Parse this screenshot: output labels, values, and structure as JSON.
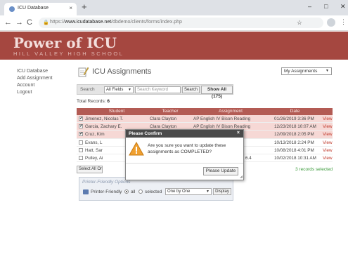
{
  "browser": {
    "tab_title": "ICU Database",
    "tab_close": "×",
    "new_tab": "+",
    "url_prefix": "https://",
    "url_host": "www.icudatabase.net",
    "url_path": "/dbdemo/clients/forms/index.php",
    "window_controls": {
      "minimize": "–",
      "maximize": "□",
      "close": "✕"
    }
  },
  "header": {
    "logo": "Power of ICU",
    "subtitle": "HILL VALLEY HIGH SCHOOL"
  },
  "sidebar": {
    "items": [
      {
        "label": "ICU Database"
      },
      {
        "label": "Add Assignment"
      },
      {
        "label": "Account"
      },
      {
        "label": "Logout"
      }
    ]
  },
  "main": {
    "title": "ICU Assignments",
    "view_select": "My Assignments",
    "search": {
      "label": "Search",
      "field": "All Fields",
      "placeholder": "Search Keyword",
      "button": "Search",
      "show_all": "Show All (175)"
    },
    "total_label": "Total Records:",
    "total_value": "6",
    "columns": [
      "Student",
      "Teacher",
      "Assignment",
      "Date"
    ],
    "rows": [
      {
        "checked": "✔",
        "student": "Jimenez, Nicolas T.",
        "teacher": "Clara Clayton",
        "assignment": "AP English IV Bison Reading",
        "date": "01/26/2019 3:36 PM",
        "view": "View"
      },
      {
        "checked": "✔",
        "student": "Garcia, Zachary E.",
        "teacher": "Clara Clayton",
        "assignment": "AP English IV Bison Reading",
        "date": "12/23/2018 10:07 AM",
        "view": "View"
      },
      {
        "checked": "✔",
        "student": "Cruz, Kim",
        "teacher": "",
        "assignment": "",
        "date": "12/09/2018 2:05 PM",
        "view": "View"
      },
      {
        "checked": "",
        "student": "Evans, L",
        "teacher": "",
        "assignment": "",
        "date": "10/13/2018 2:24 PM",
        "view": "View"
      },
      {
        "checked": "",
        "student": "Hatt, Sar",
        "teacher": "",
        "assignment": "",
        "date": "10/08/2018 4:01 PM",
        "view": "View"
      },
      {
        "checked": "",
        "student": "Pulley, Ai",
        "teacher": "",
        "assignment": "6.4",
        "date": "10/02/2018 10:31 AM",
        "view": "View"
      }
    ],
    "select_all": "Select All On",
    "records_selected": "3 records selected",
    "printer": {
      "title": "Printer-Friendly Options",
      "label": "Printer-Friendly",
      "all": "all",
      "selected": "selected",
      "mode": "One by One",
      "display": "Display"
    }
  },
  "dialog": {
    "title": "Please Confirm",
    "close": "×",
    "message": "Are you sure you want to update these assignments as COMPLETED?",
    "button": "Please Update"
  },
  "colors": {
    "brand": "#a54740",
    "table_header": "#b35b54",
    "selected_row": "#f6d8d5",
    "link": "#c0392b",
    "success": "#3a9a3a"
  }
}
